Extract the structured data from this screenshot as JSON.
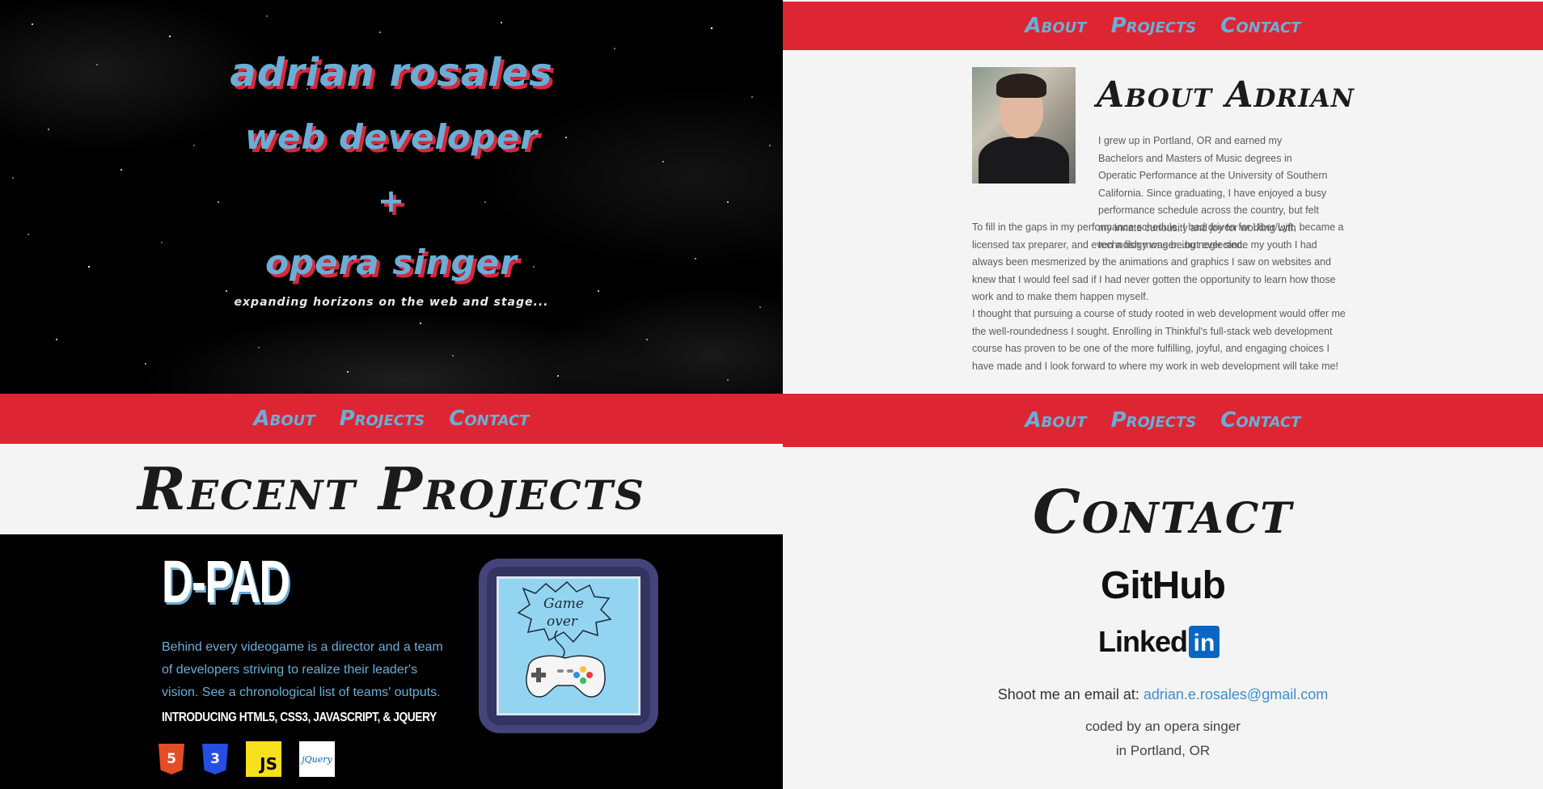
{
  "nav": {
    "about": "About",
    "projects": "Projects",
    "contact": "Contact"
  },
  "hero": {
    "name": "adrian rosales",
    "role1": "web developer",
    "plus": "+",
    "role2": "opera singer",
    "tagline": "expanding horizons on the web and stage..."
  },
  "about": {
    "title": "About Adrian",
    "para1_part1": "I grew up in Portland, OR and earned my Bachelors and Masters of Music degrees in Operatic Performance at the University of Southern California. Since graduating, I have enjoyed a busy performance schedule across the country, but felt my innate curiousity and joy for working with technology was being neglected.",
    "para1_part2": "To fill in the gaps in my performance schedule, I had driven for Uber/Lyft, became a licensed tax preparer, and even a fish monger...but ever since my youth I had always been mesmerized by the animations and graphics I saw on websites and knew that I would feel sad if I had never gotten the opportunity to learn how those work and to make them happen myself.",
    "para2": "I thought that pursuing a course of study rooted in web development would offer me the well-roundedness I sought. Enrolling in Thinkful's full-stack web development course has proven to be one of the more fulfilling, joyful, and engaging choices I have made and I look forward to where my work in web development will take me!"
  },
  "projects": {
    "title": "Recent Projects",
    "project_name": "D-PAD",
    "description": "Behind every videogame is a director and a team of developers striving to realize their leader's vision. See a chronological list of teams' outputs.",
    "tech_line": "Introducing HTML5, CSS3, JavaScript, & JQuery",
    "tech_icons": [
      "html5-icon",
      "css3-icon",
      "javascript-icon",
      "jquery-icon"
    ],
    "icon_labels": {
      "html5": "5",
      "css3": "3",
      "js": "JS",
      "jquery": "jQuery"
    },
    "image_text": {
      "line1": "Game",
      "line2": "over"
    }
  },
  "contact": {
    "title": "Contact",
    "github": "GitHub",
    "linkedin_text": "Linked",
    "linkedin_box": "in",
    "email_prefix": "Shoot me an email at: ",
    "email": "adrian.e.rosales@gmail.com",
    "credit1": "coded by an opera singer",
    "credit2": "in Portland, OR"
  },
  "colors": {
    "nav_red": "#de2534",
    "accent_blue": "#6aaed6",
    "panel_bg": "#f4f4f4",
    "link_blue": "#3b8ed4"
  }
}
